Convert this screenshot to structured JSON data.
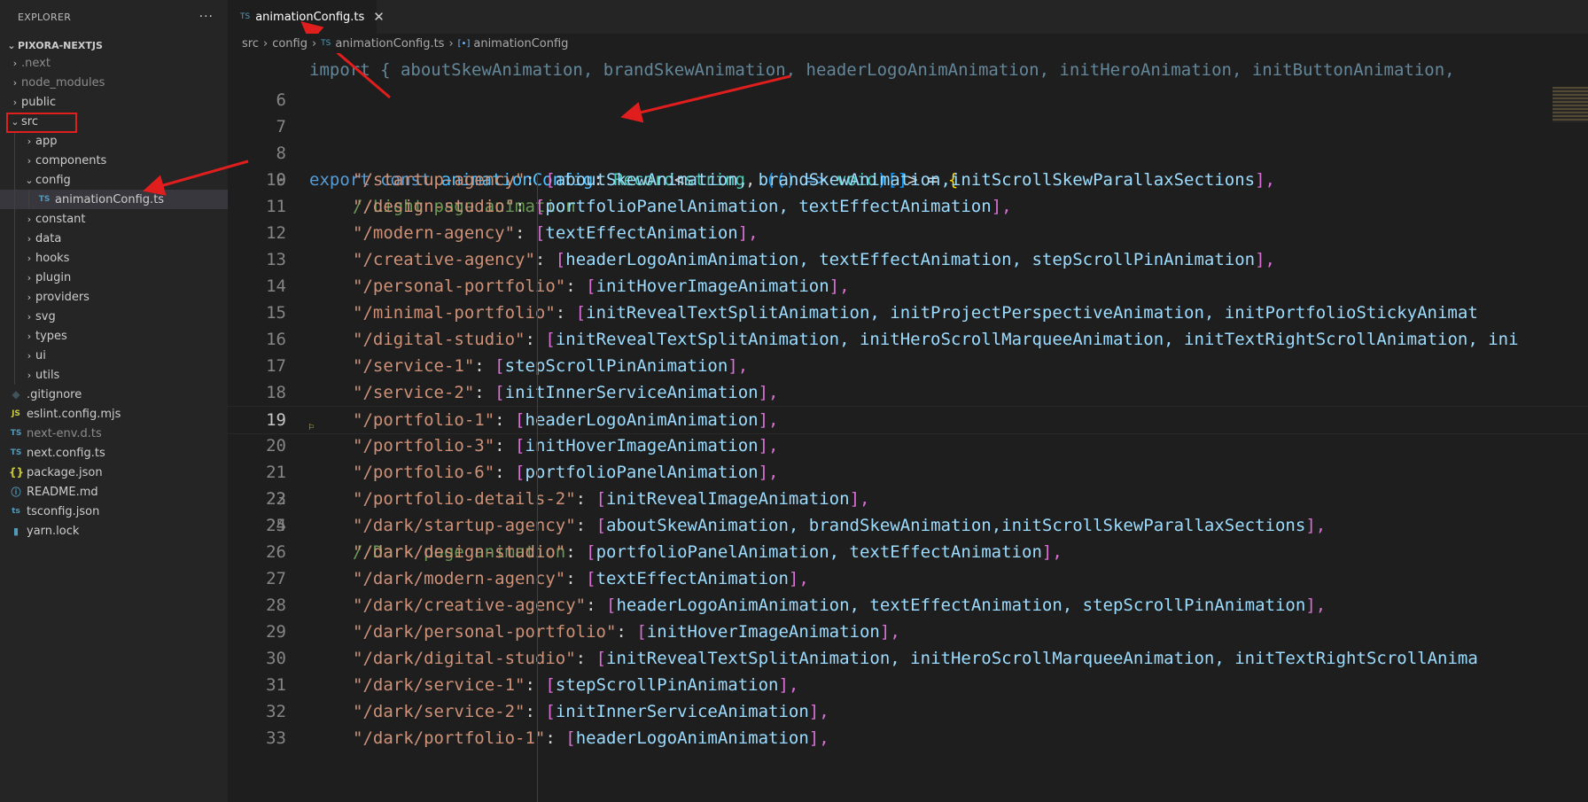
{
  "sidebar": {
    "title": "EXPLORER",
    "more": "···",
    "project": "PIXORA-NEXTJS",
    "items": [
      {
        "label": ".next",
        "chev": "›",
        "dim": true
      },
      {
        "label": "node_modules",
        "chev": "›",
        "dim": true
      },
      {
        "label": "public",
        "chev": "›"
      },
      {
        "label": "src",
        "chev": "⌄"
      },
      {
        "label": "app",
        "chev": "›"
      },
      {
        "label": "components",
        "chev": "›"
      },
      {
        "label": "config",
        "chev": "⌄"
      },
      {
        "label": "animationConfig.ts",
        "icon": "TS"
      },
      {
        "label": "constant",
        "chev": "›"
      },
      {
        "label": "data",
        "chev": "›"
      },
      {
        "label": "hooks",
        "chev": "›"
      },
      {
        "label": "plugin",
        "chev": "›"
      },
      {
        "label": "providers",
        "chev": "›"
      },
      {
        "label": "svg",
        "chev": "›"
      },
      {
        "label": "types",
        "chev": "›"
      },
      {
        "label": "ui",
        "chev": "›"
      },
      {
        "label": "utils",
        "chev": "›"
      },
      {
        "label": ".gitignore",
        "icon": "◆"
      },
      {
        "label": "eslint.config.mjs",
        "icon": "JS"
      },
      {
        "label": "next-env.d.ts",
        "icon": "TS",
        "dim": true
      },
      {
        "label": "next.config.ts",
        "icon": "TS"
      },
      {
        "label": "package.json",
        "icon": "{}"
      },
      {
        "label": "README.md",
        "icon": "ⓘ"
      },
      {
        "label": "tsconfig.json",
        "icon": "ts"
      },
      {
        "label": "yarn.lock",
        "icon": "▮"
      }
    ]
  },
  "tab": {
    "icon": "TS",
    "label": "animationConfig.ts",
    "close": "✕"
  },
  "breadcrumb": {
    "p1": "src",
    "p2": "config",
    "icon": "TS",
    "p3": "animationConfig.ts",
    "sym": "[•]",
    "p4": "animationConfig",
    "sep": "›"
  },
  "editor": {
    "line5": "import { aboutSkewAnimation, brandSkewAnimation, headerLogoAnimAnimation, initHeroAnimation, initButtonAnimation,",
    "lines": {
      "n6": "6",
      "n7": "7",
      "n8": "8",
      "n9": "9",
      "n10": "10",
      "n11": "11",
      "n12": "12",
      "n13": "13",
      "n14": "14",
      "n15": "15",
      "n16": "16",
      "n17": "17",
      "n18": "18",
      "n19": "19",
      "n20": "20",
      "n21": "21",
      "n22": "22",
      "n23": "23",
      "n24": "24",
      "n25": "25",
      "n26": "26",
      "n27": "27",
      "n28": "28",
      "n29": "29",
      "n30": "30",
      "n31": "31",
      "n32": "32",
      "n33": "33"
    },
    "export_kw": "export",
    "const_kw": "const",
    "const_name": "animationConfig",
    "record_type": "Record",
    "string_type": "string",
    "void_type": "void",
    "comment_light": "//Light page animation",
    "comment_dark": "//Dark page animation",
    "light": [
      {
        "route": "\"/startup-agency\"",
        "items": "aboutSkewAnimation, brandSkewAnimation,initScrollSkewParallaxSections",
        "close": "],"
      },
      {
        "route": "\"/design-studio\"",
        "items": "portfolioPanelAnimation, textEffectAnimation",
        "close": "],"
      },
      {
        "route": "\"/modern-agency\"",
        "items": "textEffectAnimation",
        "close": "],"
      },
      {
        "route": "\"/creative-agency\"",
        "items": "headerLogoAnimAnimation, textEffectAnimation, stepScrollPinAnimation",
        "close": "],"
      },
      {
        "route": "\"/personal-portfolio\"",
        "items": "initHoverImageAnimation",
        "close": "],"
      },
      {
        "route": "\"/minimal-portfolio\"",
        "items": "initRevealTextSplitAnimation, initProjectPerspectiveAnimation, initPortfolioStickyAnimat",
        "close": ""
      },
      {
        "route": "\"/digital-studio\"",
        "items": "initRevealTextSplitAnimation, initHeroScrollMarqueeAnimation, initTextRightScrollAnimation, ini",
        "close": ""
      },
      {
        "route": "\"/service-1\"",
        "items": "stepScrollPinAnimation",
        "close": "],"
      },
      {
        "route": "\"/service-2\"",
        "items": "initInnerServiceAnimation",
        "close": "],"
      },
      {
        "route": "\"/portfolio-1\"",
        "items": "headerLogoAnimAnimation",
        "close": "],"
      },
      {
        "route": "\"/portfolio-3\"",
        "items": "initHoverImageAnimation",
        "close": "],"
      },
      {
        "route": "\"/portfolio-6\"",
        "items": "portfolioPanelAnimation",
        "close": "],"
      },
      {
        "route": "\"/portfolio-details-2\"",
        "items": "initRevealImageAnimation",
        "close": "],"
      }
    ],
    "dark": [
      {
        "route": "\"/dark/startup-agency\"",
        "items": "aboutSkewAnimation, brandSkewAnimation,initScrollSkewParallaxSections",
        "close": "],"
      },
      {
        "route": "\"/dark/design-studio\"",
        "items": "portfolioPanelAnimation, textEffectAnimation",
        "close": "],"
      },
      {
        "route": "\"/dark/modern-agency\"",
        "items": "textEffectAnimation",
        "close": "],"
      },
      {
        "route": "\"/dark/creative-agency\"",
        "items": "headerLogoAnimAnimation, textEffectAnimation, stepScrollPinAnimation",
        "close": "],"
      },
      {
        "route": "\"/dark/personal-portfolio\"",
        "items": "initHoverImageAnimation",
        "close": "],"
      },
      {
        "route": "\"/dark/digital-studio\"",
        "items": "initRevealTextSplitAnimation, initHeroScrollMarqueeAnimation, initTextRightScrollAnima",
        "close": ""
      },
      {
        "route": "\"/dark/service-1\"",
        "items": "stepScrollPinAnimation",
        "close": "],"
      },
      {
        "route": "\"/dark/service-2\"",
        "items": "initInnerServiceAnimation",
        "close": "],"
      },
      {
        "route": "\"/dark/portfolio-1\"",
        "items": "headerLogoAnimAnimation",
        "close": "],"
      }
    ]
  },
  "colors": {
    "annotation": "#e01e1e",
    "accent": "#569cd6"
  }
}
